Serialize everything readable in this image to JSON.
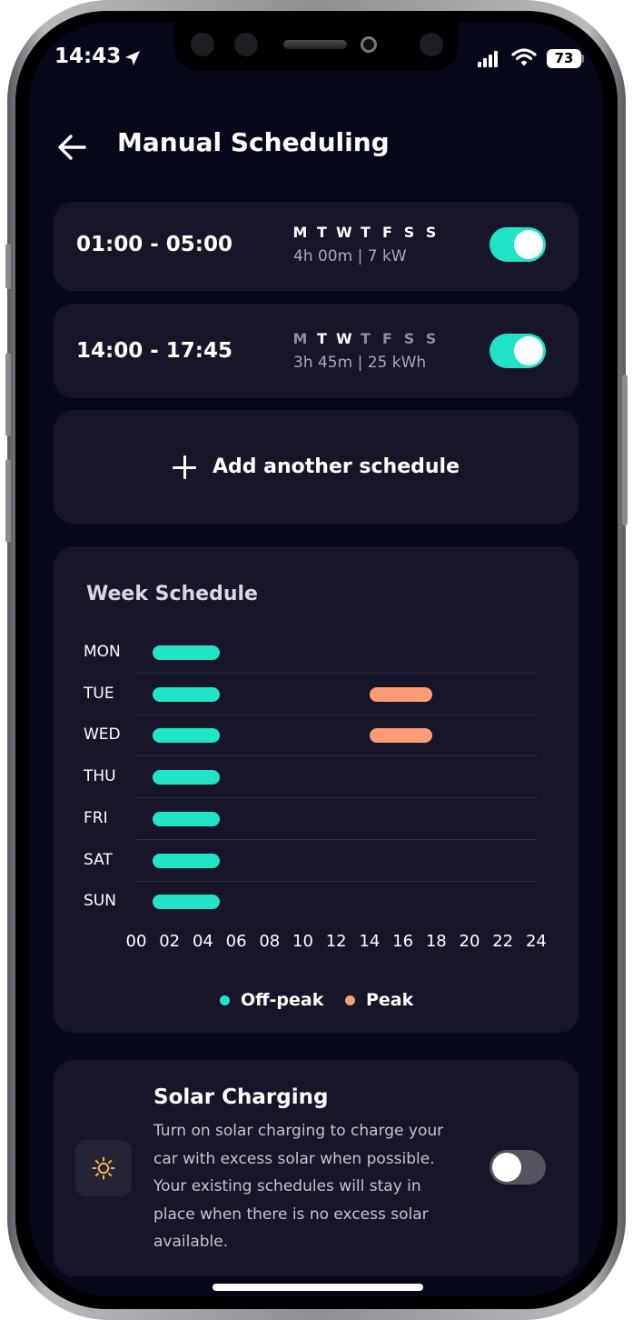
{
  "status_bar": {
    "time": "14:43",
    "battery": "73"
  },
  "header": {
    "title": "Manual Scheduling"
  },
  "day_letters": [
    "M",
    "T",
    "W",
    "T",
    "F",
    "S",
    "S"
  ],
  "schedules": [
    {
      "time": "01:00 - 05:00",
      "meta": "4h 00m | 7 kW",
      "active_days": [
        true,
        true,
        true,
        true,
        true,
        true,
        true
      ],
      "enabled": true
    },
    {
      "time": "14:00 - 17:45",
      "meta": "3h 45m | 25 kWh",
      "active_days": [
        false,
        true,
        true,
        false,
        false,
        false,
        false
      ],
      "enabled": true
    }
  ],
  "add_schedule_label": "Add another schedule",
  "week_schedule": {
    "title": "Week Schedule",
    "legend": {
      "off_peak": "Off-peak",
      "peak": "Peak"
    }
  },
  "chart_data": {
    "type": "bar",
    "title": "Week Schedule",
    "categories": [
      "MON",
      "TUE",
      "WED",
      "THU",
      "FRI",
      "SAT",
      "SUN"
    ],
    "x_ticks": [
      "00",
      "02",
      "04",
      "06",
      "08",
      "10",
      "12",
      "14",
      "16",
      "18",
      "20",
      "22",
      "24"
    ],
    "xlim": [
      0,
      24
    ],
    "series": [
      {
        "name": "Off-peak",
        "color": "#21e3c5",
        "ranges": [
          [
            1,
            5
          ],
          [
            1,
            5
          ],
          [
            1,
            5
          ],
          [
            1,
            5
          ],
          [
            1,
            5
          ],
          [
            1,
            5
          ],
          [
            1,
            5
          ]
        ]
      },
      {
        "name": "Peak",
        "color": "#ff9b75",
        "ranges": [
          null,
          [
            14,
            17.75
          ],
          [
            14,
            17.75
          ],
          null,
          null,
          null,
          null
        ]
      }
    ],
    "grid": true,
    "legend_position": "bottom"
  },
  "solar": {
    "title": "Solar Charging",
    "description": "Turn on solar charging to charge your car with excess solar when possible. Your existing schedules will stay in place when there is no excess solar available.",
    "enabled": false,
    "icon": "sun-icon"
  },
  "colors": {
    "accent": "#21e3c5",
    "peak": "#ff9b75",
    "background": "#07071a",
    "card": "#161628"
  }
}
